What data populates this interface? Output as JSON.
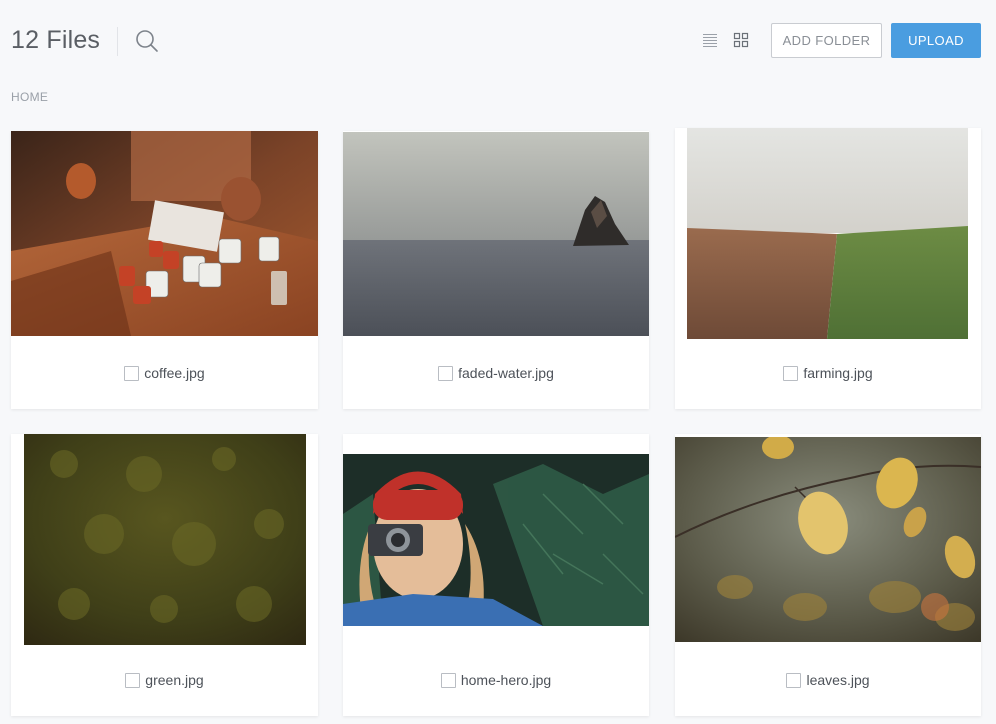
{
  "header": {
    "file_count": "12 Files",
    "add_folder_label": "ADD FOLDER",
    "upload_label": "UPLOAD",
    "icons": [
      "search-icon",
      "list-view-icon",
      "grid-view-icon"
    ]
  },
  "breadcrumb": {
    "home": "HOME"
  },
  "files": [
    {
      "name": "coffee.jpg"
    },
    {
      "name": "faded-water.jpg"
    },
    {
      "name": "farming.jpg"
    },
    {
      "name": "green.jpg"
    },
    {
      "name": "home-hero.jpg"
    },
    {
      "name": "leaves.jpg"
    }
  ],
  "colors": {
    "accent": "#4a9de0",
    "background": "#f7f8fa"
  }
}
